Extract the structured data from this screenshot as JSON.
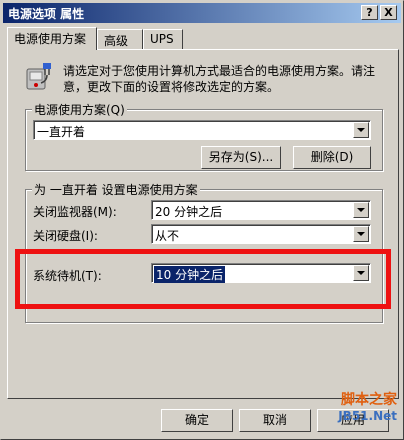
{
  "window": {
    "title": "电源选项 属性",
    "help_btn": "?",
    "close_btn": "X"
  },
  "tabs": [
    {
      "label": "电源使用方案",
      "active": true
    },
    {
      "label": "高级",
      "active": false
    },
    {
      "label": "UPS",
      "active": false
    }
  ],
  "description": "请选定对于您使用计算机方式最适合的电源使用方案。请注意，更改下面的设置将修改选定的方案。",
  "scheme_group": {
    "label": "电源使用方案(Q)",
    "selected": "一直开着",
    "save_as": "另存为(S)...",
    "delete": "删除(D)"
  },
  "settings_group": {
    "label": "为 一直开着 设置电源使用方案",
    "monitor": {
      "label": "关闭监视器(M):",
      "value": "20 分钟之后"
    },
    "disk": {
      "label": "关闭硬盘(I):",
      "value": "从不"
    },
    "standby": {
      "label": "系统待机(T):",
      "value": "10 分钟之后"
    }
  },
  "footer": {
    "ok": "确定",
    "cancel": "取消",
    "apply": "应用"
  },
  "watermark": {
    "line1": "脚本之家",
    "line2": "JB51.Net"
  },
  "colors": {
    "title_start": "#0a246a",
    "highlight": "#ee1111",
    "face": "#d4d0c8"
  },
  "icons": [
    "help-icon",
    "close-icon",
    "power-scheme-icon",
    "dropdown-arrow-icon"
  ]
}
